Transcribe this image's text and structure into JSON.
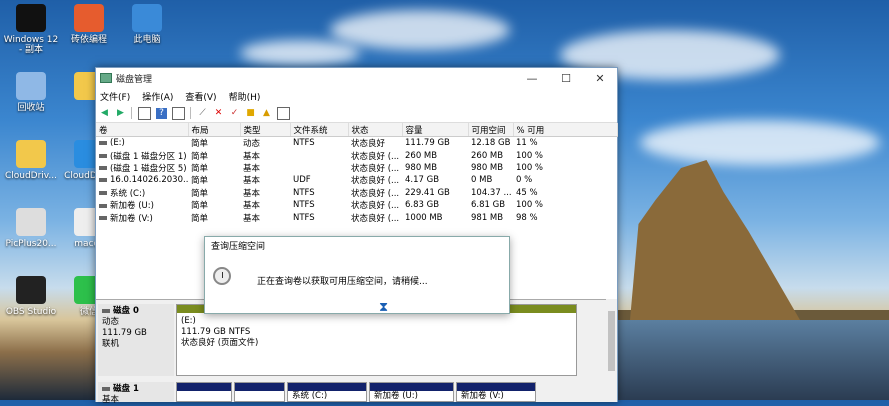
{
  "desktop": {
    "icons": [
      {
        "label": "Windows 12\n- 副本",
        "color": "#111"
      },
      {
        "label": "砖依编程",
        "color": "#e65c2e"
      },
      {
        "label": "此电脑",
        "color": "#3a8ad8"
      },
      {
        "label": "回收站",
        "color": "#8fb8e6"
      },
      {
        "label": "",
        "color": "#f2c84b"
      },
      {
        "label": "CloudDriv...",
        "color": "#f2c84b"
      },
      {
        "label": "CloudDrive",
        "color": "#2a8de0"
      },
      {
        "label": "PicPlus20...",
        "color": "#ddd"
      },
      {
        "label": "macos",
        "color": "#eee"
      },
      {
        "label": "OBS Studio",
        "color": "#222"
      },
      {
        "label": "微信",
        "color": "#2dc04b"
      }
    ]
  },
  "window": {
    "title": "磁盘管理",
    "controls": {
      "minimize": "—",
      "maximize": "☐",
      "close": "✕"
    },
    "menu": [
      "文件(F)",
      "操作(A)",
      "查看(V)",
      "帮助(H)"
    ],
    "columns": [
      "卷",
      "布局",
      "类型",
      "文件系统",
      "状态",
      "容量",
      "可用空间",
      "% 可用"
    ],
    "rows": [
      [
        "(E:)",
        "简单",
        "动态",
        "NTFS",
        "状态良好",
        "111.79 GB",
        "12.18 GB",
        "11 %"
      ],
      [
        "(磁盘 1 磁盘分区 1)",
        "简单",
        "基本",
        "",
        "状态良好 (...",
        "260 MB",
        "260 MB",
        "100 %"
      ],
      [
        "(磁盘 1 磁盘分区 5)",
        "简单",
        "基本",
        "",
        "状态良好 (...",
        "980 MB",
        "980 MB",
        "100 %"
      ],
      [
        "16.0.14026.2030...",
        "简单",
        "基本",
        "UDF",
        "状态良好 (...",
        "4.17 GB",
        "0 MB",
        "0 %"
      ],
      [
        "系统 (C:)",
        "简单",
        "基本",
        "NTFS",
        "状态良好 (...",
        "229.41 GB",
        "104.37 ...",
        "45 %"
      ],
      [
        "新加卷 (U:)",
        "简单",
        "基本",
        "NTFS",
        "状态良好 (...",
        "6.83 GB",
        "6.81 GB",
        "100 %"
      ],
      [
        "新加卷 (V:)",
        "简单",
        "基本",
        "NTFS",
        "状态良好 (...",
        "1000 MB",
        "981 MB",
        "98 %"
      ]
    ],
    "disk0": {
      "name": "磁盘 0",
      "type": "动态",
      "size": "111.79 GB",
      "status": "联机",
      "partition": {
        "name": "(E:)",
        "size": "111.79 GB NTFS",
        "status": "状态良好 (页面文件)"
      }
    },
    "disk1": {
      "name": "磁盘 1",
      "type": "基本",
      "partitions": [
        "",
        "",
        "系统 (C:)",
        "新加卷 (U:)",
        "新加卷 (V:)"
      ]
    }
  },
  "dialog": {
    "title": "查询压缩空间",
    "message": "正在查询卷以获取可用压缩空间，请稍候..."
  },
  "colors": {
    "simple_volume": "#7a8c1f",
    "primary": "#12226b"
  }
}
